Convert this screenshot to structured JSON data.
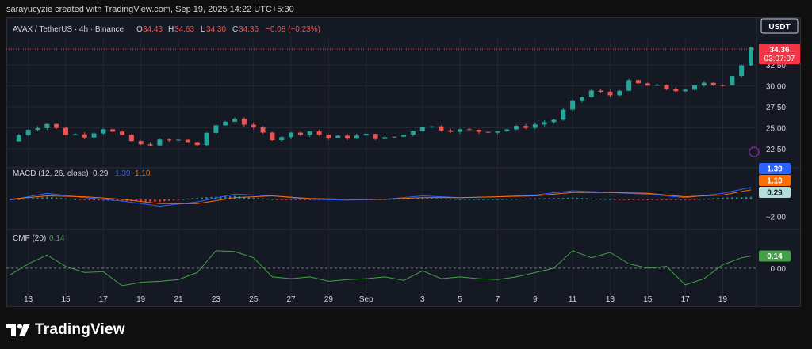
{
  "header": {
    "text": "sarayucyzie created with TradingView.com, Sep 19, 2025 14:22 UTC+5:30"
  },
  "footer": {
    "brand": "TradingView"
  },
  "colors": {
    "up": "#26a69a",
    "down": "#ef5350",
    "macd": "#2962ff",
    "signal": "#ff6d00",
    "cmf": "#43a047",
    "bg": "#151924",
    "grid": "#232732"
  },
  "chart_data": [
    {
      "type": "line",
      "title": "AVAX / TetherUS · 4h · Binance",
      "ohlc": {
        "O": "34.43",
        "H": "34.63",
        "L": "34.30",
        "C": "34.36",
        "change": "−0.08 (−0.23%)"
      },
      "currency": "USDT",
      "price_tag": {
        "value": "34.36",
        "countdown": "03:07:07"
      },
      "y_ticks": [
        "22.50",
        "25.00",
        "27.50",
        "30.00",
        "32.50"
      ],
      "ylim": [
        21,
        35.5
      ],
      "x_ticks": [
        "13",
        "15",
        "17",
        "19",
        "21",
        "23",
        "25",
        "27",
        "29",
        "Sep",
        "3",
        "5",
        "7",
        "9",
        "11",
        "13",
        "15",
        "17",
        "19"
      ],
      "close_by_day": [
        {
          "x": 12,
          "y": 23.4
        },
        {
          "x": 13,
          "y": 24.9
        },
        {
          "x": 14,
          "y": 25.5
        },
        {
          "x": 15,
          "y": 24.3
        },
        {
          "x": 16,
          "y": 24.1
        },
        {
          "x": 17,
          "y": 25.0
        },
        {
          "x": 18,
          "y": 23.9
        },
        {
          "x": 19,
          "y": 22.9
        },
        {
          "x": 20,
          "y": 23.4
        },
        {
          "x": 21,
          "y": 23.5
        },
        {
          "x": 22,
          "y": 23.0
        },
        {
          "x": 23,
          "y": 25.3
        },
        {
          "x": 24,
          "y": 26.2
        },
        {
          "x": 25,
          "y": 24.8
        },
        {
          "x": 26,
          "y": 23.8
        },
        {
          "x": 27,
          "y": 24.3
        },
        {
          "x": 28,
          "y": 24.6
        },
        {
          "x": 29,
          "y": 23.8
        },
        {
          "x": 30,
          "y": 23.9
        },
        {
          "x": 31,
          "y": 24.1
        },
        {
          "x": 32,
          "y": 23.7
        },
        {
          "x": 33,
          "y": 24.2
        },
        {
          "x": 34,
          "y": 25.3
        },
        {
          "x": 35,
          "y": 24.9
        },
        {
          "x": 36,
          "y": 24.7
        },
        {
          "x": 37,
          "y": 24.6
        },
        {
          "x": 38,
          "y": 24.7
        },
        {
          "x": 39,
          "y": 25.0
        },
        {
          "x": 40,
          "y": 25.4
        },
        {
          "x": 41,
          "y": 26.0
        },
        {
          "x": 42,
          "y": 28.0
        },
        {
          "x": 43,
          "y": 29.4
        },
        {
          "x": 44,
          "y": 28.9
        },
        {
          "x": 45,
          "y": 30.4
        },
        {
          "x": 46,
          "y": 30.0
        },
        {
          "x": 47,
          "y": 29.7
        },
        {
          "x": 48,
          "y": 29.3
        },
        {
          "x": 49,
          "y": 30.4
        },
        {
          "x": 50,
          "y": 30.2
        },
        {
          "x": 51,
          "y": 32.3
        },
        {
          "x": 51.5,
          "y": 34.36
        }
      ]
    },
    {
      "type": "line",
      "title": "MACD (12, 26, close)",
      "values": {
        "hist": "0.29",
        "macd": "1.39",
        "signal": "1.10"
      },
      "y_ticks": [
        "−2.00"
      ],
      "series": [
        {
          "name": "MACD",
          "x": [
            12,
            14,
            16,
            18,
            20,
            22,
            24,
            26,
            28,
            30,
            32,
            34,
            36,
            38,
            40,
            42,
            44,
            46,
            48,
            50,
            51.5
          ],
          "values": [
            -0.1,
            0.7,
            0.2,
            -0.2,
            -0.8,
            -0.3,
            0.6,
            0.4,
            0.0,
            -0.1,
            0.0,
            0.4,
            0.2,
            0.3,
            0.5,
            1.0,
            0.8,
            0.6,
            0.2,
            0.7,
            1.39
          ]
        },
        {
          "name": "Signal",
          "x": [
            12,
            14,
            16,
            18,
            20,
            22,
            24,
            26,
            28,
            30,
            32,
            34,
            36,
            38,
            40,
            42,
            44,
            46,
            48,
            50,
            51.5
          ],
          "values": [
            0.0,
            0.4,
            0.3,
            0.0,
            -0.5,
            -0.5,
            0.2,
            0.4,
            0.1,
            0.0,
            0.0,
            0.2,
            0.2,
            0.3,
            0.4,
            0.8,
            0.8,
            0.7,
            0.3,
            0.5,
            1.1
          ]
        }
      ],
      "ylim": [
        -2.6,
        2.2
      ]
    },
    {
      "type": "line",
      "title": "CMF (20)",
      "values": {
        "cmf": "0.14"
      },
      "y_ticks": [
        "0.00"
      ],
      "series": [
        {
          "name": "CMF",
          "x": [
            12,
            13,
            14,
            15,
            16,
            17,
            18,
            19,
            20,
            21,
            22,
            23,
            24,
            25,
            26,
            27,
            28,
            29,
            30,
            31,
            32,
            33,
            34,
            35,
            36,
            37,
            38,
            39,
            40,
            41,
            42,
            43,
            44,
            45,
            46,
            47,
            48,
            49,
            50,
            51,
            51.5
          ],
          "values": [
            -0.08,
            0.05,
            0.15,
            0.02,
            -0.05,
            -0.04,
            -0.2,
            -0.16,
            -0.15,
            -0.13,
            -0.05,
            0.2,
            0.19,
            0.12,
            -0.1,
            -0.12,
            -0.1,
            -0.15,
            -0.13,
            -0.12,
            -0.1,
            -0.14,
            -0.03,
            -0.12,
            -0.1,
            -0.12,
            -0.13,
            -0.1,
            -0.05,
            0.0,
            0.2,
            0.12,
            0.18,
            0.05,
            0.0,
            0.02,
            -0.19,
            -0.12,
            0.04,
            0.12,
            0.14
          ]
        }
      ],
      "ylim": [
        -0.3,
        0.28
      ]
    }
  ]
}
